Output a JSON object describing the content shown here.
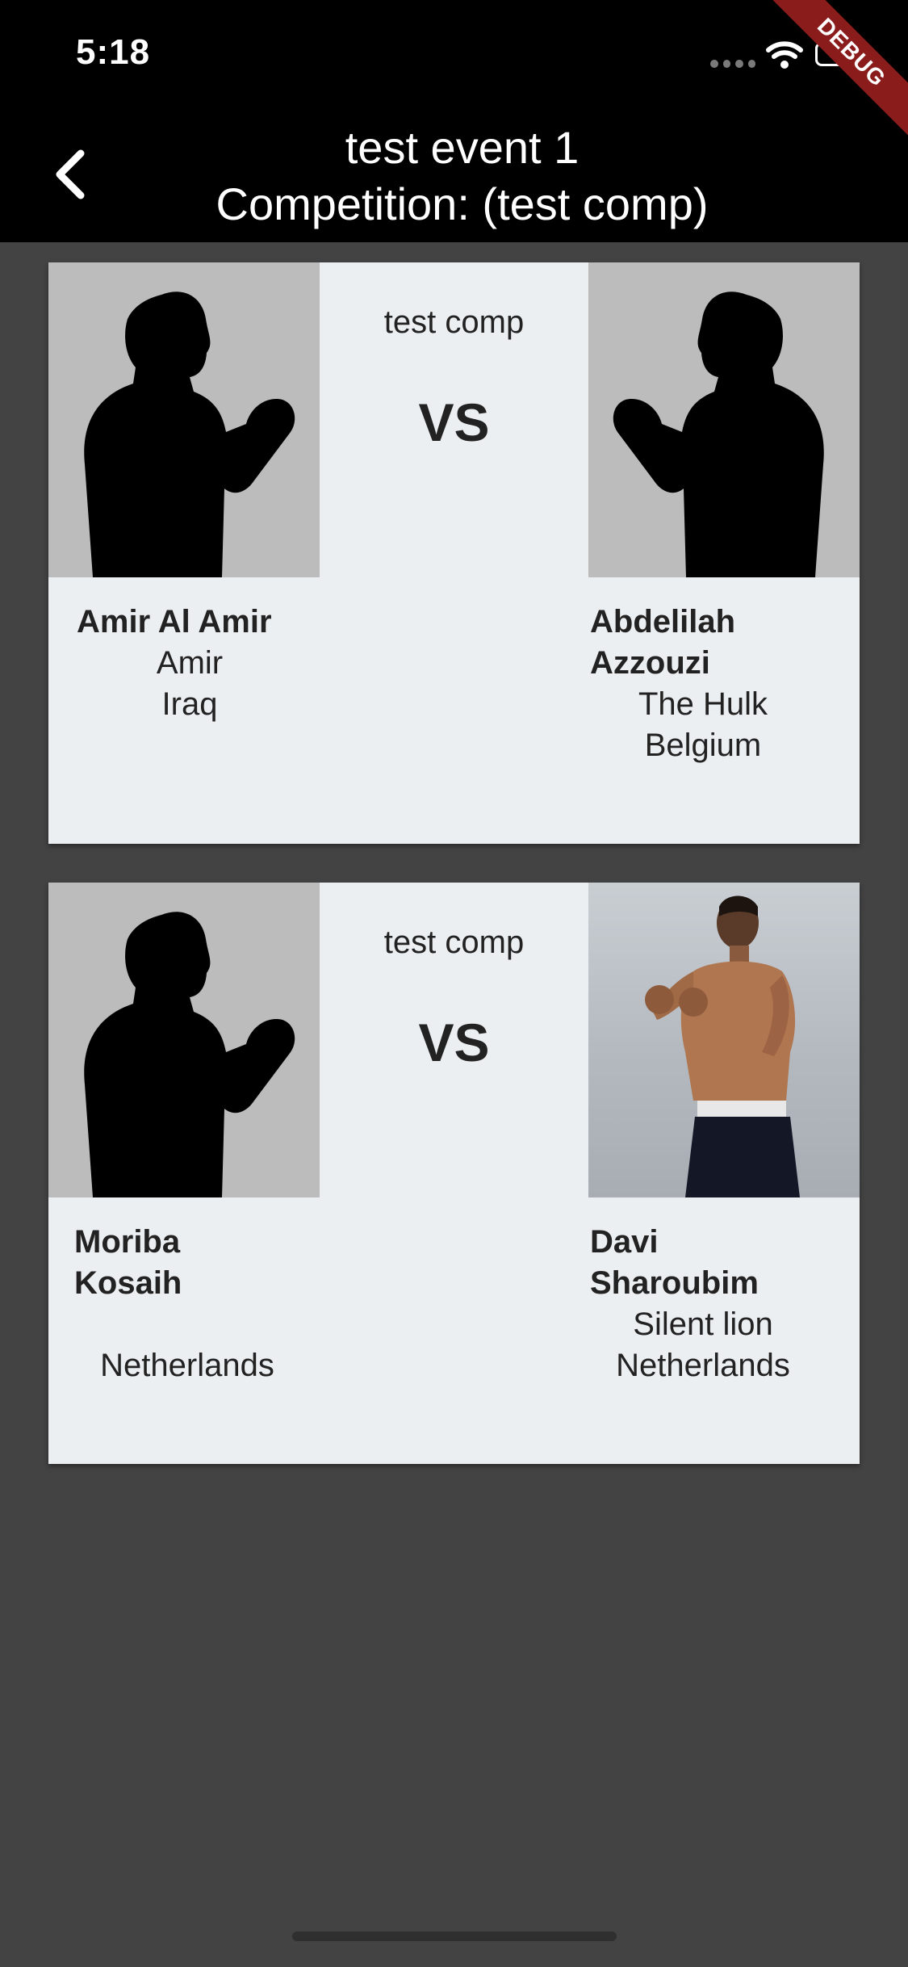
{
  "status": {
    "time": "5:18",
    "debug_banner": "DEBUG"
  },
  "header": {
    "title_line1": "test event 1",
    "title_line2": "Competition: (test comp)"
  },
  "matches": [
    {
      "competition": "test comp",
      "vs": "VS",
      "left": {
        "name": "Amir Al Amir",
        "nickname": "Amir",
        "country": "Iraq",
        "photo": "silhouette"
      },
      "right": {
        "name": "Abdelilah Azzouzi",
        "nickname": "The Hulk",
        "country": "Belgium",
        "photo": "silhouette"
      }
    },
    {
      "competition": "test comp",
      "vs": "VS",
      "left": {
        "name": "Moriba Kosaih",
        "nickname": "",
        "country": "Netherlands",
        "photo": "silhouette"
      },
      "right": {
        "name": "Davi Sharoubim",
        "nickname": "Silent lion",
        "country": "Netherlands",
        "photo": "photo"
      }
    }
  ],
  "colors": {
    "background": "#434343",
    "card": "#eceff2",
    "header": "#000000",
    "banner": "#8a1c1c"
  }
}
